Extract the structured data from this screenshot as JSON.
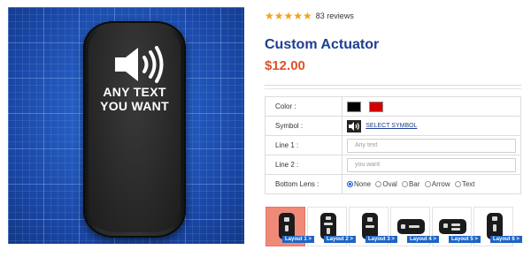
{
  "product": {
    "image": {
      "switch_text_line1": "ANY TEXT",
      "switch_text_line2": "YOU WANT",
      "icon": "speaker-icon"
    },
    "rating": {
      "stars": "★★★★★",
      "reviews": "83 reviews",
      "value": 5
    },
    "title": "Custom Actuator",
    "price": "$12.00"
  },
  "options": {
    "color": {
      "label": "Color :",
      "swatches": [
        "#000000",
        "#d40000"
      ],
      "swatch_names": [
        "black",
        "red"
      ]
    },
    "symbol": {
      "label": "Symbol :",
      "link": "SELECT SYMBOL",
      "icon": "speaker-icon"
    },
    "line1": {
      "label": "Line 1 :",
      "placeholder": "Any text",
      "value": ""
    },
    "line2": {
      "label": "Line 2 :",
      "placeholder": "you want",
      "value": ""
    },
    "bottom_lens": {
      "label": "Bottom Lens :",
      "choices": [
        "None",
        "Oval",
        "Bar",
        "Arrow",
        "Text"
      ],
      "selected": "None"
    }
  },
  "layouts": [
    {
      "label": "Layout 1 >",
      "active": true
    },
    {
      "label": "Layout 2 >",
      "active": false
    },
    {
      "label": "Layout 3 >",
      "active": false
    },
    {
      "label": "Layout 4 >",
      "active": false
    },
    {
      "label": "Layout 5 >",
      "active": false
    },
    {
      "label": "Layout 6 >",
      "active": false
    }
  ],
  "colors": {
    "accent_blue": "#1c3f8f",
    "price_orange": "#e0502a",
    "star_gold": "#f5a21c",
    "tag_blue": "#1d64c4",
    "active_layout": "#ef8a78"
  }
}
